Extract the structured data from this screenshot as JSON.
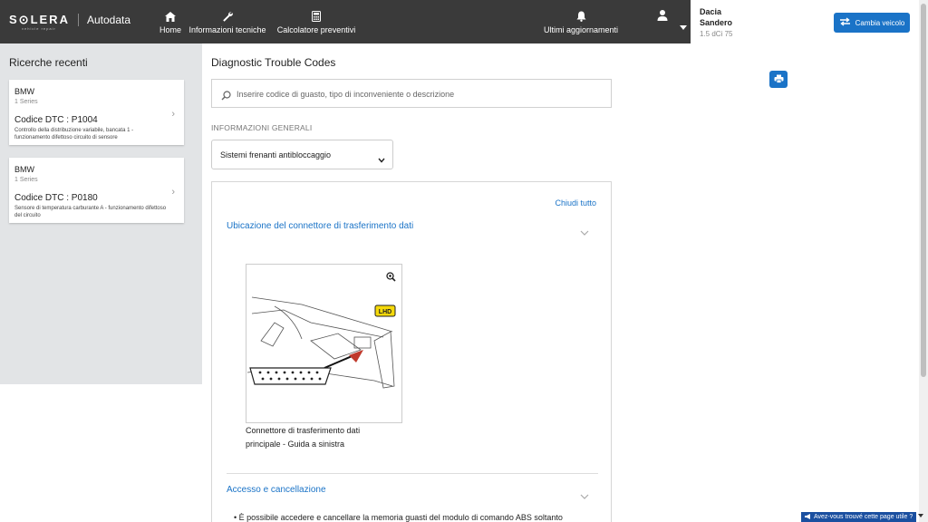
{
  "header": {
    "logo_text": "S⊙LERA",
    "logo_subtext": "vehicle repair",
    "brand": "Autodata",
    "nav": [
      {
        "label": "Home",
        "icon": "home-icon"
      },
      {
        "label": "Informazioni tecniche",
        "icon": "wrench-icon"
      },
      {
        "label": "Calcolatore preventivi",
        "icon": "calculator-icon"
      },
      {
        "label": "Ultimi aggiornamenti",
        "icon": "bell-icon"
      }
    ],
    "user_icon": "user-icon"
  },
  "vehicle": {
    "make": "Dacia",
    "model": "Sandero",
    "engine": "1.5 dCi 75",
    "change_label": "Cambia veicolo"
  },
  "sidebar": {
    "title": "Ricerche recenti",
    "items": [
      {
        "make": "BMW",
        "series": "1 Series",
        "code": "Codice DTC : P1004",
        "desc": "Controllo della distribuzione variabile, bancata 1 - funzionamento difettoso circuito di sensore"
      },
      {
        "make": "BMW",
        "series": "1 Series",
        "code": "Codice DTC : P0180",
        "desc": "Sensore di temperatura carburante A - funzionamento difettoso del circuito"
      }
    ]
  },
  "main": {
    "title": "Diagnostic Trouble Codes",
    "search_placeholder": "Inserire codice di guasto, tipo di inconveniente o descrizione",
    "general_label": "INFORMAZIONI GENERALI",
    "system_select": "Sistemi frenanti antibloccaggio",
    "close_all": "Chiudi tutto",
    "sections": [
      {
        "title": "Ubicazione del connettore di trasferimento dati"
      },
      {
        "title": "Accesso e cancellazione"
      }
    ],
    "figure_badge": "LHD",
    "figure_caption_1": "Connettore di trasferimento dati",
    "figure_caption_2": "principale - Guida a sinistra",
    "bullet_text": "È possibile accedere e cancellare la memoria guasti del modulo di comando ABS soltanto"
  },
  "feedback": {
    "label": "Avez-vous trouvé cette page utile ?"
  },
  "colors": {
    "accent": "#1a73c7",
    "topbar": "#3a3a3a",
    "sidebar": "#e2e4e6"
  }
}
